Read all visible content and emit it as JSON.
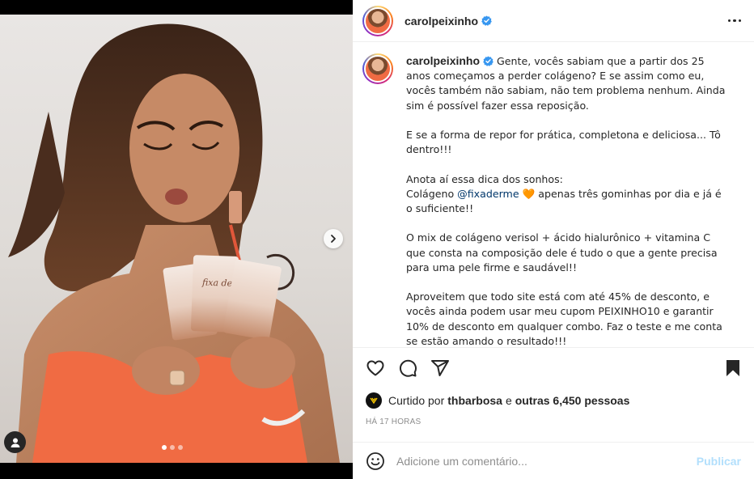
{
  "post": {
    "username": "carolpeixinho",
    "verified": true,
    "media": {
      "brand_on_packets": "fixa derme",
      "carousel_dots": 3,
      "active_dot": 0
    }
  },
  "caption": {
    "username": "carolpeixinho",
    "p1": "Gente, vocês sabiam que a partir dos 25 anos começamos a perder colágeno? E se assim como eu, vocês também não sabiam, não tem problema nenhum. Ainda sim é possível fazer essa reposição.",
    "p2": "E se a forma de repor for prática, completona e deliciosa... Tô dentro!!!",
    "p3_line1": "Anota aí essa dica dos sonhos:",
    "p3_pre": "Colágeno ",
    "p3_mention": "@fixaderme",
    "p3_emoji": "🧡",
    "p3_post": " apenas três gominhas por dia e já é o suficiente!!",
    "p4": "O mix de colágeno verisol + ácido hialurônico + vitamina C que consta na composição dele é tudo o que a gente precisa para uma pele firme e saudável!!",
    "p5": "Aproveitem que todo site está com até 45% de desconto, e vocês ainda podem usar meu cupom PEIXINHO10 e garantir 10% de desconto em qualquer combo. Faz o teste e me conta se estão amando o resultado!!!"
  },
  "likes": {
    "prefix": "Curtido por",
    "user": "thbarbosa",
    "and": "e",
    "others": "outras 6,450 pessoas"
  },
  "timestamp": "HÁ 17 HORAS",
  "comment": {
    "placeholder": "Adicione um comentário...",
    "publish_label": "Publicar"
  },
  "icons": [
    "verified-badge-icon",
    "more-options-icon",
    "heart-icon",
    "comment-icon",
    "share-icon",
    "bookmark-icon",
    "emoji-icon",
    "tag-user-icon",
    "chevron-right-icon"
  ],
  "colors": {
    "verified": "#3897f0",
    "mention": "#00376b",
    "publish_disabled": "#b2dffc",
    "muted": "#8e8e8e",
    "dress": "#f06b43"
  }
}
